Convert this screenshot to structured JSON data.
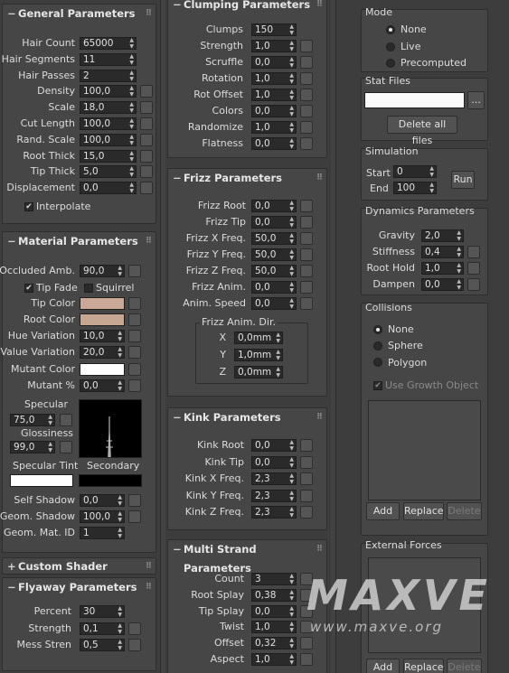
{
  "general": {
    "title": "General Parameters",
    "rows": [
      {
        "label": "Hair Count",
        "value": "65000"
      },
      {
        "label": "Hair Segments",
        "value": "11"
      },
      {
        "label": "Hair Passes",
        "value": "2"
      },
      {
        "label": "Density",
        "value": "100,0"
      },
      {
        "label": "Scale",
        "value": "18,0"
      },
      {
        "label": "Cut Length",
        "value": "100,0"
      },
      {
        "label": "Rand. Scale",
        "value": "100,0"
      },
      {
        "label": "Root Thick",
        "value": "15,0"
      },
      {
        "label": "Tip Thick",
        "value": "5,0"
      },
      {
        "label": "Displacement",
        "value": "0,0"
      }
    ],
    "interpolate": "Interpolate"
  },
  "material": {
    "title": "Material Parameters",
    "occluded": {
      "label": "Occluded Amb.",
      "value": "90,0"
    },
    "tip_fade": "Tip Fade",
    "squirrel": "Squirrel",
    "tip_color": {
      "label": "Tip Color",
      "color": "#c9a896"
    },
    "root_color": {
      "label": "Root Color",
      "color": "#c6a792"
    },
    "hue_var": {
      "label": "Hue Variation",
      "value": "10,0"
    },
    "value_var": {
      "label": "Value Variation",
      "value": "20,0"
    },
    "mutant_color": {
      "label": "Mutant Color",
      "color": "#ffffff"
    },
    "mutant_pct": {
      "label": "Mutant %",
      "value": "0,0"
    },
    "specular": {
      "label": "Specular",
      "value": "75,0"
    },
    "glossiness": {
      "label": "Glossiness",
      "value": "99,0"
    },
    "spec_tint": "Specular Tint",
    "secondary": "Secondary",
    "self_shadow": {
      "label": "Self Shadow",
      "value": "0,0"
    },
    "geom_shadow": {
      "label": "Geom. Shadow",
      "value": "100,0"
    },
    "geom_mat": {
      "label": "Geom. Mat. ID",
      "value": "1"
    }
  },
  "custom_shader": {
    "title": "Custom Shader"
  },
  "flyaway": {
    "title": "Flyaway Parameters",
    "rows": [
      {
        "label": "Percent",
        "value": "30"
      },
      {
        "label": "Strength",
        "value": "0,1"
      },
      {
        "label": "Mess Stren",
        "value": "0,5"
      }
    ]
  },
  "clumping": {
    "title": "Clumping Parameters",
    "rows": [
      {
        "label": "Clumps",
        "value": "150"
      },
      {
        "label": "Strength",
        "value": "1,0"
      },
      {
        "label": "Scruffle",
        "value": "0,0"
      },
      {
        "label": "Rotation",
        "value": "1,0"
      },
      {
        "label": "Rot Offset",
        "value": "1,0"
      },
      {
        "label": "Colors",
        "value": "0,0"
      },
      {
        "label": "Randomize",
        "value": "1,0"
      },
      {
        "label": "Flatness",
        "value": "0,0"
      }
    ]
  },
  "frizz": {
    "title": "Frizz Parameters",
    "rows": [
      {
        "label": "Frizz Root",
        "value": "0,0"
      },
      {
        "label": "Frizz Tip",
        "value": "0,0"
      },
      {
        "label": "Frizz X Freq.",
        "value": "50,0"
      },
      {
        "label": "Frizz Y Freq.",
        "value": "50,0"
      },
      {
        "label": "Frizz Z Freq.",
        "value": "50,0"
      },
      {
        "label": "Frizz Anim.",
        "value": "0,0"
      },
      {
        "label": "Anim. Speed",
        "value": "0,0"
      }
    ],
    "dir_title": "Frizz Anim. Dir.",
    "dir": [
      {
        "label": "X",
        "value": "0,0mm"
      },
      {
        "label": "Y",
        "value": "1,0mm"
      },
      {
        "label": "Z",
        "value": "0,0mm"
      }
    ]
  },
  "kink": {
    "title": "Kink Parameters",
    "rows": [
      {
        "label": "Kink Root",
        "value": "0,0"
      },
      {
        "label": "Kink Tip",
        "value": "0,0"
      },
      {
        "label": "Kink X Freq.",
        "value": "2,3"
      },
      {
        "label": "Kink Y Freq.",
        "value": "2,3"
      },
      {
        "label": "Kink Z Freq.",
        "value": "2,3"
      }
    ]
  },
  "multistrand": {
    "title": "Multi Strand Parameters",
    "rows": [
      {
        "label": "Count",
        "value": "3"
      },
      {
        "label": "Root Splay",
        "value": "0,38"
      },
      {
        "label": "Tip Splay",
        "value": "0,0"
      },
      {
        "label": "Twist",
        "value": "1,0"
      },
      {
        "label": "Offset",
        "value": "0,32"
      },
      {
        "label": "Aspect",
        "value": "1,0"
      }
    ]
  },
  "mode": {
    "title": "Mode",
    "options": [
      "None",
      "Live",
      "Precomputed"
    ]
  },
  "stat": {
    "title": "Stat Files",
    "browse": "...",
    "delete_all": "Delete all files"
  },
  "simulation": {
    "title": "Simulation",
    "start": {
      "label": "Start",
      "value": "0"
    },
    "end": {
      "label": "End",
      "value": "100"
    },
    "run": "Run"
  },
  "dynamics": {
    "title": "Dynamics Parameters",
    "rows": [
      {
        "label": "Gravity",
        "value": "2,0"
      },
      {
        "label": "Stiffness",
        "value": "0,4"
      },
      {
        "label": "Root Hold",
        "value": "1,0"
      },
      {
        "label": "Dampen",
        "value": "0,0"
      }
    ]
  },
  "collisions": {
    "title": "Collisions",
    "options": [
      "None",
      "Sphere",
      "Polygon"
    ],
    "use_growth": "Use Growth Object",
    "add": "Add",
    "replace": "Replace",
    "delete": "Delete"
  },
  "external": {
    "title": "External Forces",
    "add": "Add",
    "replace": "Replace",
    "delete": "Delete"
  },
  "watermark": {
    "brand": "MAXVE",
    "url": "www.maxve.org"
  }
}
